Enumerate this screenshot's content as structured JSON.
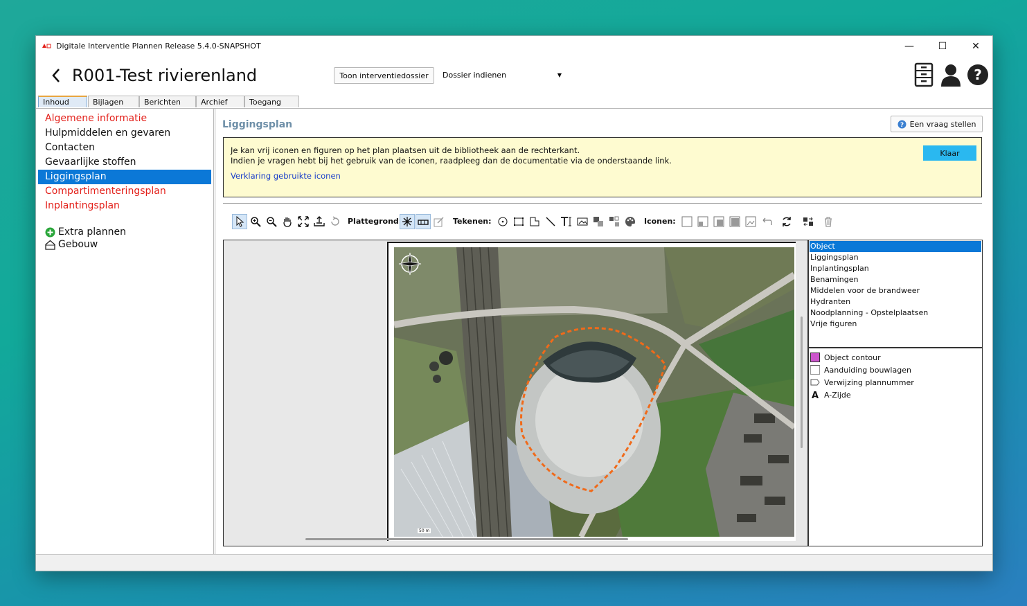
{
  "window": {
    "title": "Digitale Interventie Plannen Release 5.4.0-SNAPSHOT",
    "controls": {
      "minimize": "—",
      "maximize": "☐",
      "close": "✕"
    }
  },
  "header": {
    "title": "R001-Test rivierenland",
    "show_dossier_button": "Toon interventiedossier",
    "dossier_select": {
      "selected": "Dossier indienen"
    },
    "icons": [
      "cabinet-icon",
      "user-icon",
      "help-icon"
    ]
  },
  "tabs": [
    {
      "label": "Inhoud",
      "active": true
    },
    {
      "label": "Bijlagen"
    },
    {
      "label": "Berichten"
    },
    {
      "label": "Archief"
    },
    {
      "label": "Toegang"
    }
  ],
  "sidebar": {
    "items": [
      {
        "label": "Algemene informatie",
        "status": "red"
      },
      {
        "label": "Hulpmiddelen en gevaren",
        "status": "normal"
      },
      {
        "label": "Contacten",
        "status": "normal"
      },
      {
        "label": "Gevaarlijke stoffen",
        "status": "normal"
      },
      {
        "label": "Liggingsplan",
        "status": "selected"
      },
      {
        "label": "Compartimenteringsplan",
        "status": "red"
      },
      {
        "label": "Inplantingsplan",
        "status": "red"
      }
    ],
    "extra": [
      {
        "label": "Extra plannen",
        "icon": "add-circle-icon"
      },
      {
        "label": "Gebouw",
        "icon": "building-icon"
      }
    ]
  },
  "content": {
    "title": "Liggingsplan",
    "ask_button": "Een vraag stellen",
    "info": {
      "line1": "Je kan vrij iconen en figuren op het plan plaatsen uit de bibliotheek aan de rechterkant.",
      "line2": "Indien je vragen hebt bij het gebruik van de iconen, raadpleeg dan de documentatie via de onderstaande link.",
      "link": "Verklaring gebruikte iconen",
      "close_button": "Klaar"
    },
    "toolbar": {
      "plattegrond_label": "Plattegrond:",
      "tekenen_label": "Tekenen:",
      "iconen_label": "Iconen:"
    },
    "map": {
      "scale_label": "50 m",
      "north_label": "N"
    },
    "layers": [
      "Object",
      "Liggingsplan",
      "Inplantingsplan",
      "Benamingen",
      "Middelen voor de brandweer",
      "Hydranten",
      "Noodplanning - Opstelplaatsen",
      "Vrije figuren"
    ],
    "selected_layer": "Object",
    "legend": [
      {
        "label": "Object contour",
        "icon": "object-contour-swatch",
        "color": "#c040c0"
      },
      {
        "label": "Aanduiding bouwlagen",
        "icon": "bouwlagen-swatch"
      },
      {
        "label": "Verwijzing plannummer",
        "icon": "plannummer-icon"
      },
      {
        "label": "A-Zijde",
        "icon": "a-side-icon"
      }
    ]
  },
  "colors": {
    "accent": "#0b78d7",
    "warning_text": "#e3201a",
    "info_bg": "#fefbd0",
    "klaar": "#2ab8f0",
    "contour": "#f06a1a"
  }
}
